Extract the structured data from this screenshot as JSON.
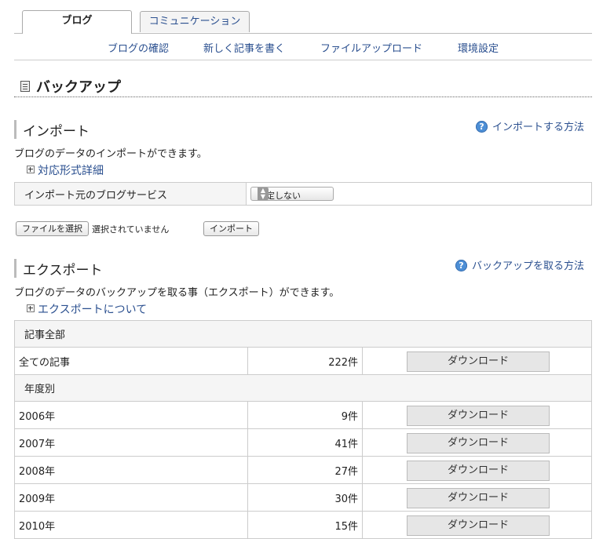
{
  "tabs": [
    {
      "label": "ブログ",
      "active": true
    },
    {
      "label": "コミュニケーション",
      "active": false
    }
  ],
  "subnav": [
    "ブログの確認",
    "新しく記事を書く",
    "ファイルアップロード",
    "環境設定"
  ],
  "page_title": "バックアップ",
  "import": {
    "heading": "インポート",
    "help": "インポートする方法",
    "description": "ブログのデータのインポートができます。",
    "toggle": "対応形式詳細",
    "source_label": "インポート元のブログサービス",
    "source_value": "指定しない",
    "file_button": "ファイルを選択",
    "no_file": "選択されていません",
    "import_button": "インポート"
  },
  "export": {
    "heading": "エクスポート",
    "help": "バックアップを取る方法",
    "description": "ブログのデータのバックアップを取る事（エクスポート）ができます。",
    "toggle": "エクスポートについて",
    "group_all": "記事全部",
    "all_label": "全ての記事",
    "all_count": "222件",
    "group_year": "年度別",
    "download_label": "ダウンロード",
    "years": [
      {
        "year": "2006年",
        "count": "9件"
      },
      {
        "year": "2007年",
        "count": "41件"
      },
      {
        "year": "2008年",
        "count": "27件"
      },
      {
        "year": "2009年",
        "count": "30件"
      },
      {
        "year": "2010年",
        "count": "15件"
      }
    ]
  },
  "colors": {
    "link": "#2a4f8f",
    "help_icon": "#4d8fd6"
  }
}
